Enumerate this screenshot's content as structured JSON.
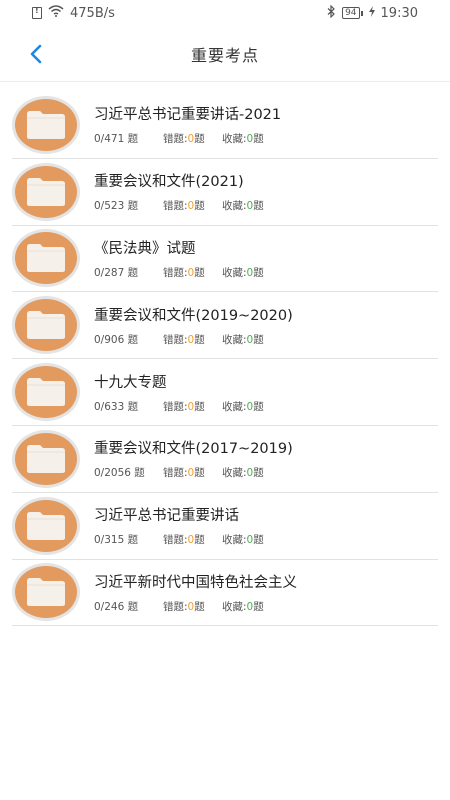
{
  "status_bar": {
    "speed": "475B/s",
    "battery": "94",
    "time": "19:30"
  },
  "header": {
    "title": "重要考点"
  },
  "labels": {
    "wrong": "错题:",
    "favorite": "收藏:",
    "unit": "题"
  },
  "items": [
    {
      "title": "习近平总书记重要讲话-2021",
      "progress": "0/471 题",
      "wrong": "0",
      "favorite": "0"
    },
    {
      "title": "重要会议和文件(2021)",
      "progress": "0/523 题",
      "wrong": "0",
      "favorite": "0"
    },
    {
      "title": "《民法典》试题",
      "progress": "0/287 题",
      "wrong": "0",
      "favorite": "0"
    },
    {
      "title": "重要会议和文件(2019~2020)",
      "progress": "0/906 题",
      "wrong": "0",
      "favorite": "0"
    },
    {
      "title": "十九大专题",
      "progress": "0/633 题",
      "wrong": "0",
      "favorite": "0"
    },
    {
      "title": "重要会议和文件(2017~2019)",
      "progress": "0/2056 题",
      "wrong": "0",
      "favorite": "0"
    },
    {
      "title": "习近平总书记重要讲话",
      "progress": "0/315 题",
      "wrong": "0",
      "favorite": "0"
    },
    {
      "title": "习近平新时代中国特色社会主义",
      "progress": "0/246 题",
      "wrong": "0",
      "favorite": "0"
    }
  ],
  "colors": {
    "accent": "#1e88e5",
    "folder": "#e29a5f",
    "wrong_count": "#f0a030",
    "favorite_count": "#4caf50"
  }
}
